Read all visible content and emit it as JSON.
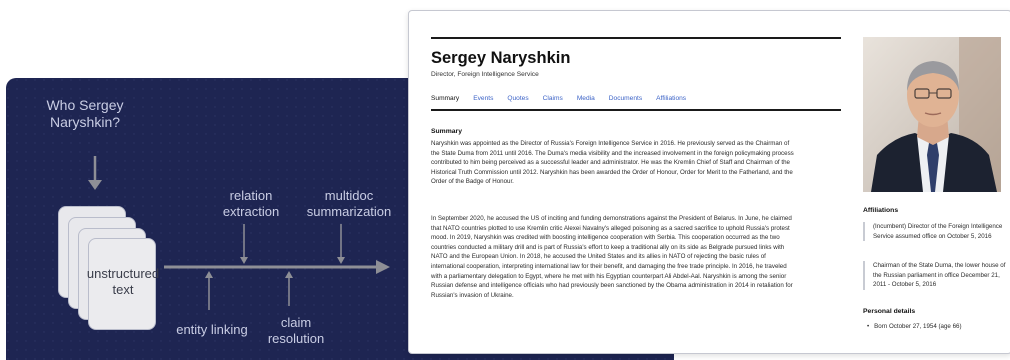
{
  "diagram": {
    "question": "Who Sergey Naryshkin?",
    "relation_extraction": "relation extraction",
    "multidoc_summarization": "multidoc summarization",
    "documents_label": "unstructured text",
    "entity_linking": "entity linking",
    "claim_resolution": "claim resolution"
  },
  "profile": {
    "name": "Sergey Naryshkin",
    "subtitle": "Director, Foreign Intelligence Service",
    "tabs": [
      "Summary",
      "Events",
      "Quotes",
      "Claims",
      "Media",
      "Documents",
      "Affiliations"
    ],
    "active_tab": "Summary",
    "section_title": "Summary",
    "paragraphs": [
      "Naryshkin was appointed as the Director of Russia's Foreign Intelligence Service in 2016. He previously served as the Chairman of the State Duma from 2011 until 2016.  The Duma's media visibility and the increased involvement in the foreign policymaking process contributed to him being perceived as a successful leader and administrator. He was the Kremlin Chief of Staff and Chairman of the Historical Truth Commission until 2012. Naryshkin has been awarded the Order of Honour, Order for Merit to the Fatherland, and the Order of the Badge of Honour.",
      "In September 2020, he accused the US of inciting and funding demonstrations against the President of Belarus. In June, he claimed that NATO countries plotted to use Kremlin critic Alexei Navalny's alleged poisoning as a sacred sacrifice to uphold Russia's protest mood. In 2019, Naryshkin was credited with boosting intelligence cooperation with Serbia. This cooperation occurred as the two countries conducted a military drill and is part of Russia's effort to keep a traditional ally on its side as Belgrade pursued links with NATO and the European Union.  In 2018, he accused the United States and its allies in NATO of rejecting the basic rules of international cooperation, interpreting international law for their benefit, and damaging the free trade principle. In 2016, he traveled with a parliamentary delegation to Egypt, where he met with his  Egyptian counterpart Ali Abdel-Aal. Naryshkin is among the senior Russian defense and intelligence officials who had previously been sanctioned by the Obama administration in 2014 in retaliation for Russian's invasion of Ukraine."
    ],
    "affiliations_title": "Affiliations",
    "affiliations": [
      "(Incumbent) Director of the Foreign Intelligence Service assumed office on October 5, 2016",
      "Chairman of the State Duma, the lower house of the Russian parliament in office December 21, 2011 - October 5, 2016"
    ],
    "personal_title": "Personal details",
    "personal": [
      "Born October 27, 1954 (age 66)"
    ]
  }
}
